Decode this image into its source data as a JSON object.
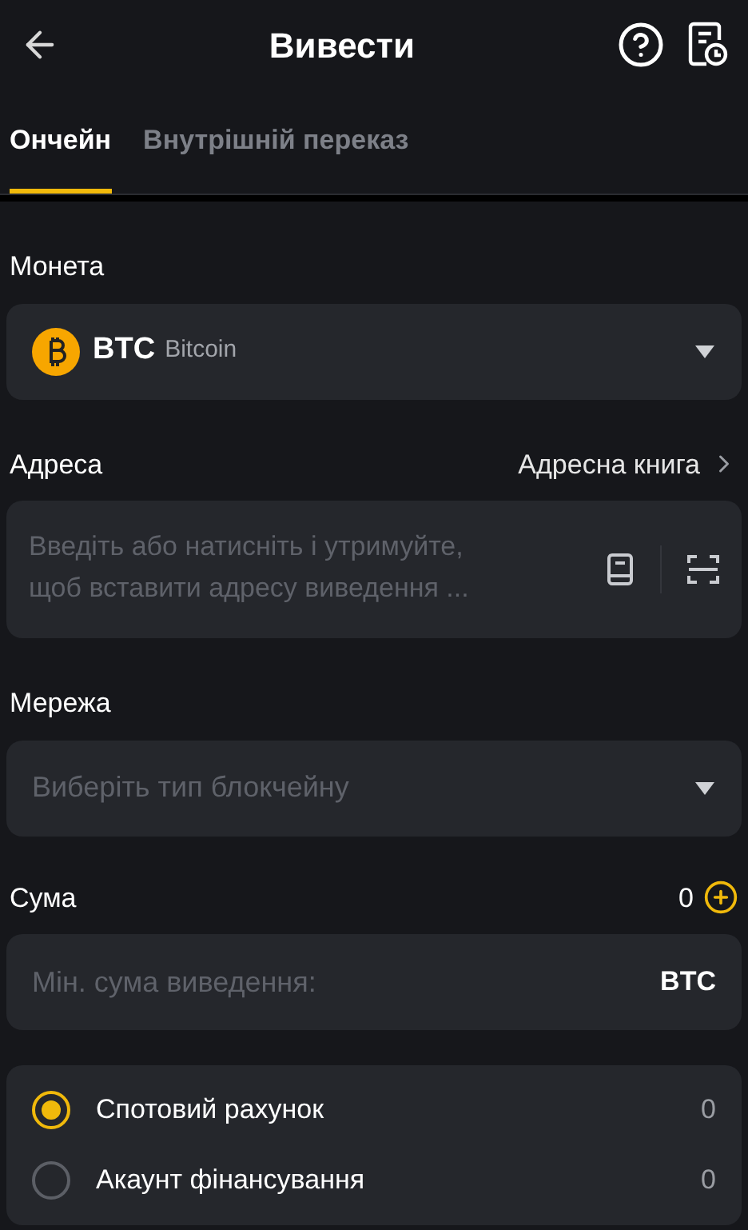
{
  "header": {
    "title": "Вивести"
  },
  "tabs": [
    {
      "label": "Ончейн",
      "selected": true
    },
    {
      "label": "Внутрішній переказ",
      "selected": false
    }
  ],
  "coin": {
    "label": "Монета",
    "symbol": "BTC",
    "name": "Bitcoin"
  },
  "address": {
    "label": "Адреса",
    "link": "Адресна книга",
    "placeholder": "Введіть або натисніть і утримуйте,\nщоб вставити адресу виведення ..."
  },
  "network": {
    "label": "Мережа",
    "placeholder": "Виберіть тип блокчейну"
  },
  "amount": {
    "label": "Сума",
    "balance": "0",
    "placeholder": "Мін. сума виведення:",
    "unit": "BTC"
  },
  "accounts": [
    {
      "label": "Спотовий рахунок",
      "value": "0",
      "selected": true
    },
    {
      "label": "Акаунт фінансування",
      "value": "0",
      "selected": false
    }
  ]
}
